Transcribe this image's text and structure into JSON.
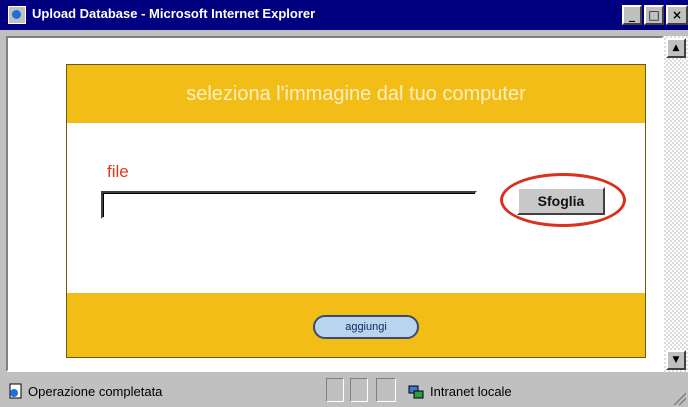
{
  "window": {
    "title": "Upload Database - Microsoft Internet Explorer",
    "minimize_glyph": "_",
    "maximize_glyph": "□",
    "close_glyph": "×"
  },
  "form": {
    "heading": "seleziona l'immagine dal tuo computer",
    "file_label": "file",
    "file_value": "",
    "browse_label": "Sfoglia",
    "add_label": "aggiungi"
  },
  "statusbar": {
    "status_text": "Operazione completata",
    "zone_text": "Intranet locale"
  },
  "colors": {
    "form_band": "#f2bd17",
    "file_label": "#e23a1a",
    "highlight_ring": "#d8321c",
    "titlebar": "#000080"
  },
  "icons": [
    "ie-page-icon",
    "done-page-icon",
    "local-intranet-icon"
  ]
}
